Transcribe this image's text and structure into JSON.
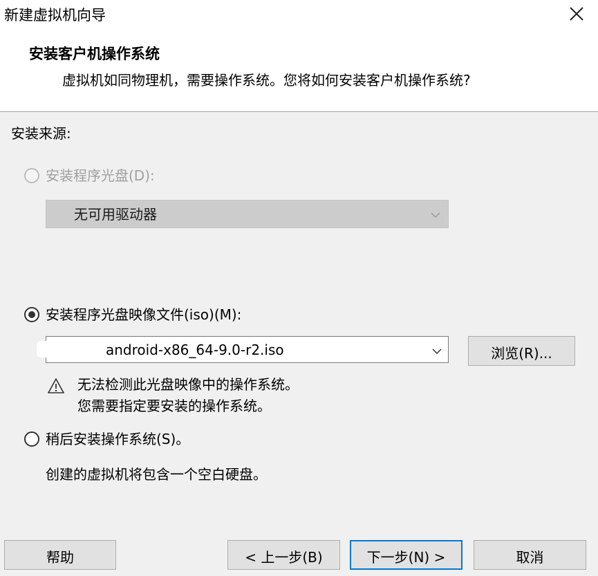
{
  "window": {
    "title": "新建虚拟机向导"
  },
  "header": {
    "step_title": "安装客户机操作系统",
    "step_desc": "虚拟机如同物理机，需要操作系统。您将如何安装客户机操作系统?"
  },
  "install_source": {
    "label": "安装来源:",
    "disc_option": {
      "label": "安装程序光盘(D):",
      "selected": false,
      "enabled": false
    },
    "drive_select": {
      "value": "无可用驱动器",
      "enabled": false
    },
    "iso_option": {
      "label": "安装程序光盘映像文件(iso)(M):",
      "selected": true
    },
    "iso_path": {
      "value": "android-x86_64-9.0-r2.iso"
    },
    "browse_button": "浏览(R)...",
    "warning": {
      "line1": "无法检测此光盘映像中的操作系统。",
      "line2": "您需要指定要安装的操作系统。"
    },
    "later_option": {
      "label": "稍后安装操作系统(S)。",
      "selected": false
    },
    "later_desc": "创建的虚拟机将包含一个空白硬盘。"
  },
  "footer": {
    "help": "帮助",
    "back": "< 上一步(B)",
    "next": "下一步(N) >",
    "cancel": "取消"
  },
  "icons": [
    "close-icon",
    "chevron-down-icon",
    "warning-icon"
  ]
}
